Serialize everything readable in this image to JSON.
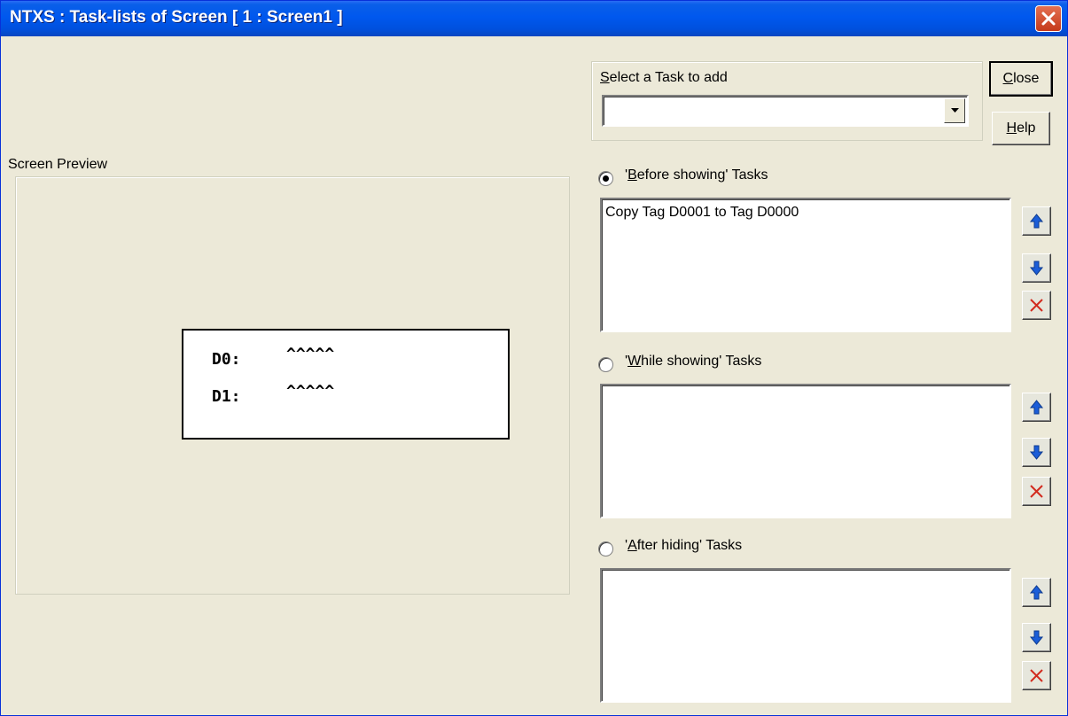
{
  "window": {
    "title": "NTXS : Task-lists of Screen [ 1 : Screen1 ]"
  },
  "select_task": {
    "label_first": "S",
    "label_rest": "elect a Task to add",
    "value": ""
  },
  "buttons": {
    "close_first": "C",
    "close_rest": "lose",
    "help_first": "H",
    "help_rest": "elp"
  },
  "preview": {
    "label": "Screen Preview",
    "lines": [
      {
        "tag": "D0:",
        "value": "^^^^^"
      },
      {
        "tag": "D1:",
        "value": "^^^^^"
      }
    ]
  },
  "task_lists": [
    {
      "pre": "'",
      "key": "B",
      "post": "efore showing' Tasks",
      "selected": true,
      "items": [
        "Copy Tag D0001 to Tag D0000"
      ]
    },
    {
      "pre": "'",
      "key": "W",
      "post": "hile showing' Tasks",
      "selected": false,
      "items": []
    },
    {
      "pre": "'",
      "key": "A",
      "post": "fter hiding' Tasks",
      "selected": false,
      "items": []
    }
  ],
  "icons": {
    "up": "arrow-up-icon",
    "down": "arrow-down-icon",
    "delete": "delete-x-icon",
    "colors": {
      "arrow": "#1b5dd8",
      "delete": "#d22a1e",
      "title_bar": "#0058ee"
    }
  }
}
